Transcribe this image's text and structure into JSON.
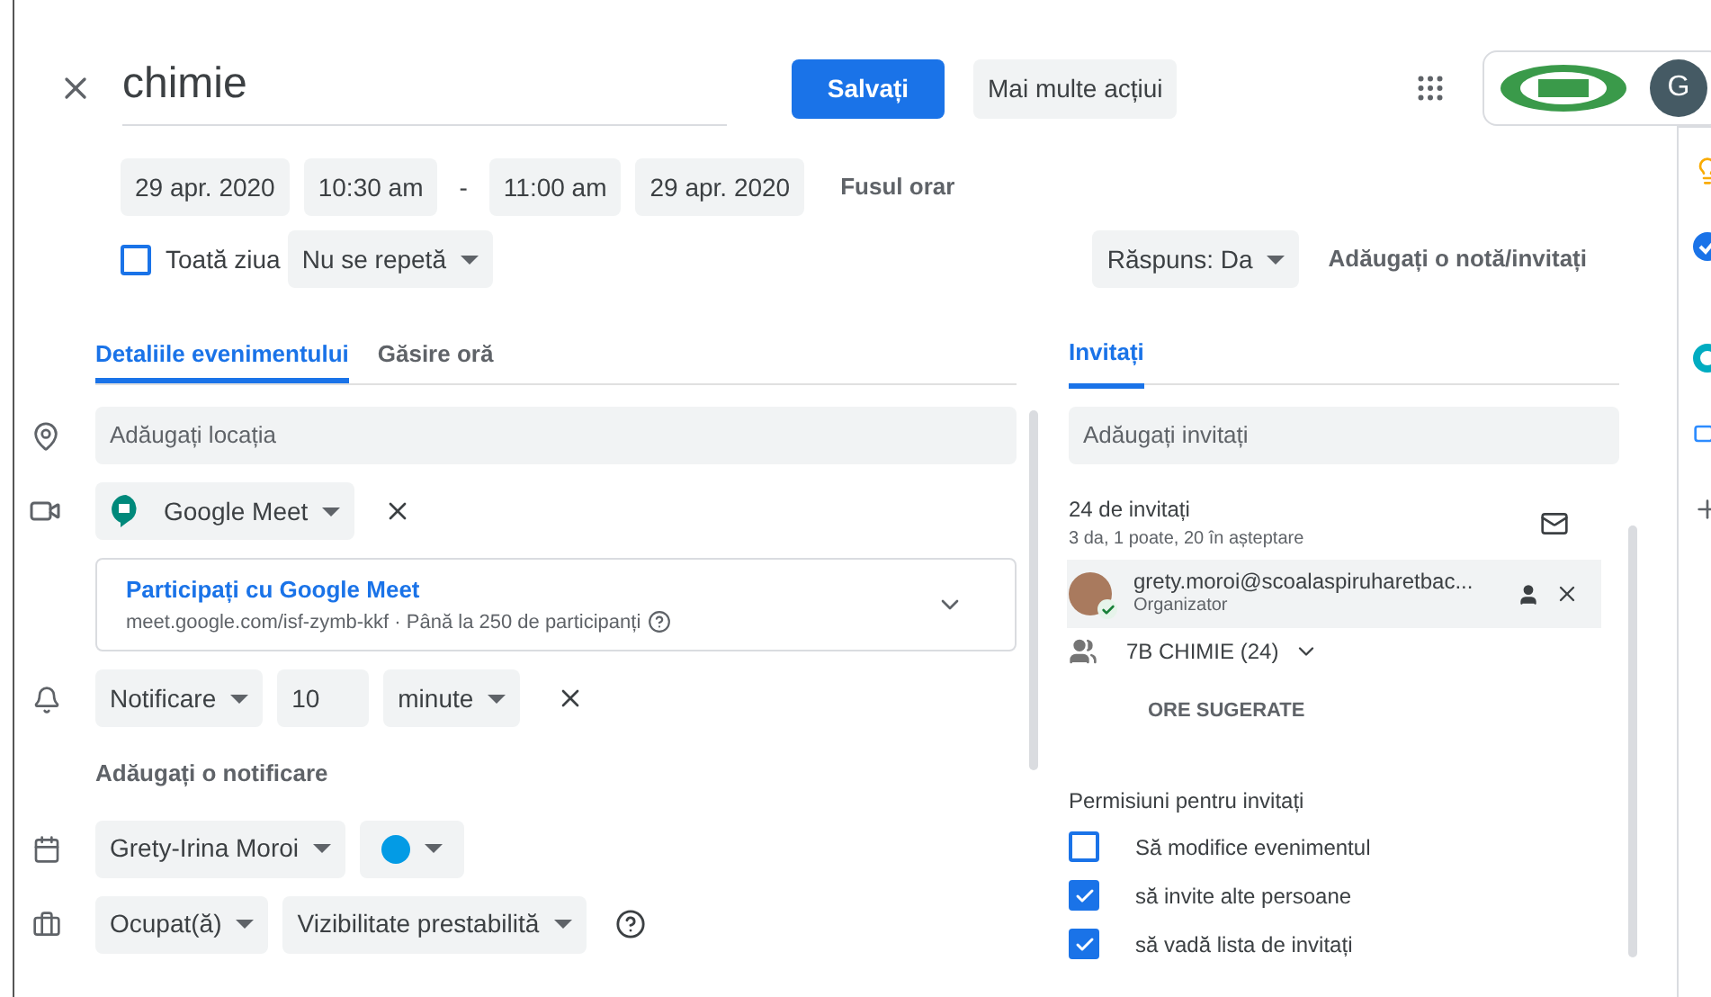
{
  "title": "chimie",
  "header": {
    "save": "Salvați",
    "more": "Mai multe acțiui",
    "avatar": "G"
  },
  "dates": {
    "start_date": "29 apr. 2020",
    "start_time": "10:30 am",
    "separator": "-",
    "end_time": "11:00 am",
    "end_date": "29 apr. 2020",
    "timezone": "Fusul orar"
  },
  "all_day": {
    "label": "Toată ziua",
    "checked": false
  },
  "repeat": "Nu se repetă",
  "response": "Răspuns: Da",
  "add_note": "Adăugați o notă/invitați",
  "tabs": [
    {
      "label": "Detaliile evenimentului",
      "selected": true
    },
    {
      "label": "Găsire oră",
      "selected": false
    }
  ],
  "location": {
    "placeholder": "Adăugați locația"
  },
  "conference": {
    "name": "Google Meet",
    "join": "Participați cu Google Meet",
    "details": "meet.google.com/isf-zymb-kkf · Până la 250 de participanți"
  },
  "notification": {
    "type": "Notificare",
    "value": "10",
    "unit": "minute"
  },
  "add_notification": "Adăugați o notificare",
  "calendar": {
    "owner": "Grety-Irina Moroi",
    "color": "#039be5"
  },
  "availability": "Ocupat(ă)",
  "visibility": "Vizibilitate prestabilită",
  "guests_tab": "Invitați",
  "guests": {
    "placeholder": "Adăugați invitați",
    "count": "24 de invitați",
    "summary": "3 da, 1 poate, 20 în așteptare",
    "organizer": {
      "email": "grety.moroi@scoalaspiruharetbac...",
      "role": "Organizator"
    },
    "group": "7B CHIMIE (24)",
    "suggested": "ORE SUGERATE"
  },
  "permissions": {
    "title": "Permisiuni pentru invitați",
    "items": [
      {
        "label": "Să modifice evenimentul",
        "checked": false
      },
      {
        "label": "să invite alte persoane",
        "checked": true
      },
      {
        "label": "să vadă lista de invitați",
        "checked": true
      }
    ]
  }
}
